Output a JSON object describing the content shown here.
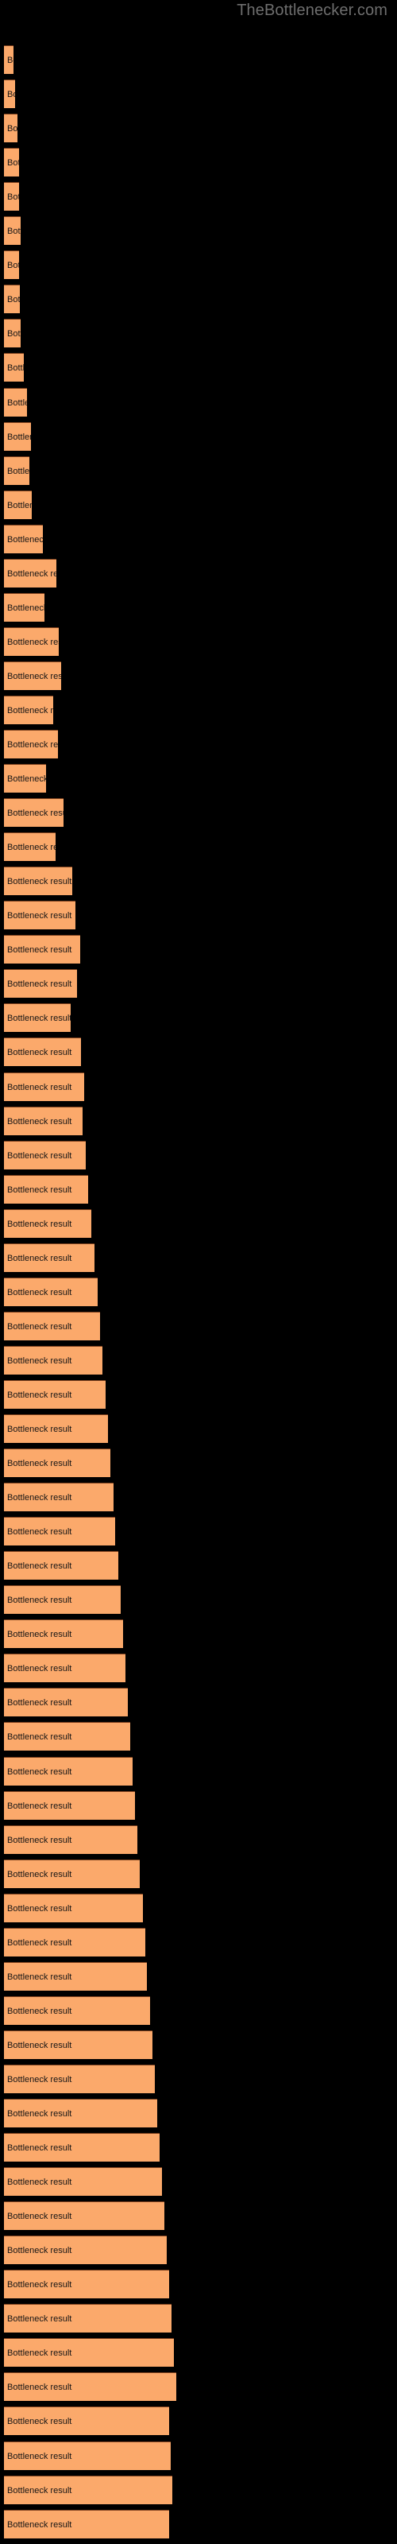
{
  "site": {
    "watermark": "TheBottlenecker.com"
  },
  "colors": {
    "background": "#000000",
    "bar_fill": "#fba96b",
    "bar_border_top": "#7a3f1d",
    "bar_label_text": "#151515",
    "watermark_text": "#6e6e6e"
  },
  "chart_data": {
    "type": "bar",
    "orientation": "horizontal",
    "title": "",
    "subtitle": "",
    "xlabel": "",
    "ylabel": "",
    "grid": false,
    "legend": false,
    "legend_position": "none",
    "bar_label": "Bottleneck result",
    "x_axis_unit": "percent",
    "xlim": [
      0,
      100
    ],
    "categories": [
      "Bottleneck result",
      "Bottleneck result",
      "Bottleneck result",
      "Bottleneck result",
      "Bottleneck result",
      "Bottleneck result",
      "Bottleneck result",
      "Bottleneck result",
      "Bottleneck result",
      "Bottleneck result",
      "Bottleneck result",
      "Bottleneck result",
      "Bottleneck result",
      "Bottleneck result",
      "Bottleneck result",
      "Bottleneck result",
      "Bottleneck result",
      "Bottleneck result",
      "Bottleneck result",
      "Bottleneck result",
      "Bottleneck result",
      "Bottleneck result",
      "Bottleneck result",
      "Bottleneck result",
      "Bottleneck result",
      "Bottleneck result",
      "Bottleneck result",
      "Bottleneck result",
      "Bottleneck result",
      "Bottleneck result",
      "Bottleneck result",
      "Bottleneck result",
      "Bottleneck result",
      "Bottleneck result",
      "Bottleneck result",
      "Bottleneck result",
      "Bottleneck result",
      "Bottleneck result",
      "Bottleneck result",
      "Bottleneck result",
      "Bottleneck result",
      "Bottleneck result",
      "Bottleneck result",
      "Bottleneck result",
      "Bottleneck result",
      "Bottleneck result",
      "Bottleneck result",
      "Bottleneck result",
      "Bottleneck result",
      "Bottleneck result",
      "Bottleneck result",
      "Bottleneck result",
      "Bottleneck result",
      "Bottleneck result",
      "Bottleneck result",
      "Bottleneck result",
      "Bottleneck result",
      "Bottleneck result",
      "Bottleneck result",
      "Bottleneck result",
      "Bottleneck result",
      "Bottleneck result",
      "Bottleneck result",
      "Bottleneck result",
      "Bottleneck result",
      "Bottleneck result",
      "Bottleneck result",
      "Bottleneck result",
      "Bottleneck result",
      "Bottleneck result",
      "Bottleneck result",
      "Bottleneck result",
      "Bottleneck result"
    ],
    "values": [
      5.6,
      6.6,
      7.8,
      8.8,
      8.6,
      9.5,
      8.8,
      9.0,
      9.7,
      11.4,
      13.1,
      15.4,
      14.6,
      15.8,
      22.4,
      30.3,
      23.3,
      31.7,
      33.0,
      28.2,
      31.1,
      24.4,
      34.4,
      29.6,
      39.2,
      41.3,
      43.8,
      42.1,
      38.3,
      44.2,
      46.2,
      45.3,
      47.0,
      48.3,
      50.2,
      52.1,
      53.9,
      55.2,
      56.8,
      58.4,
      59.7,
      61.3,
      62.8,
      64.1,
      65.5,
      67.0,
      68.3,
      69.8,
      71.1,
      72.6,
      74.0,
      75.3,
      76.8,
      78.1,
      79.6,
      81.0,
      82.3,
      83.8,
      85.1,
      86.6,
      88.0,
      89.3,
      90.8,
      92.1,
      93.6,
      95.0,
      96.3,
      97.8,
      99.1,
      100.0,
      100.0,
      100.0,
      100.0
    ],
    "bar_pixel_widths": [
      12,
      14,
      17,
      19,
      19,
      21,
      19,
      20,
      21,
      25,
      29,
      34,
      32,
      35,
      49,
      66,
      51,
      69,
      72,
      62,
      68,
      53,
      75,
      65,
      86,
      90,
      96,
      92,
      84,
      97,
      101,
      99,
      103,
      106,
      110,
      114,
      118,
      121,
      124,
      128,
      131,
      134,
      138,
      140,
      144,
      147,
      150,
      153,
      156,
      159,
      162,
      165,
      168,
      171,
      175,
      178,
      180,
      184,
      187,
      190,
      193,
      196,
      199,
      202,
      205,
      208,
      211,
      214,
      217,
      208,
      210,
      212,
      208
    ]
  }
}
